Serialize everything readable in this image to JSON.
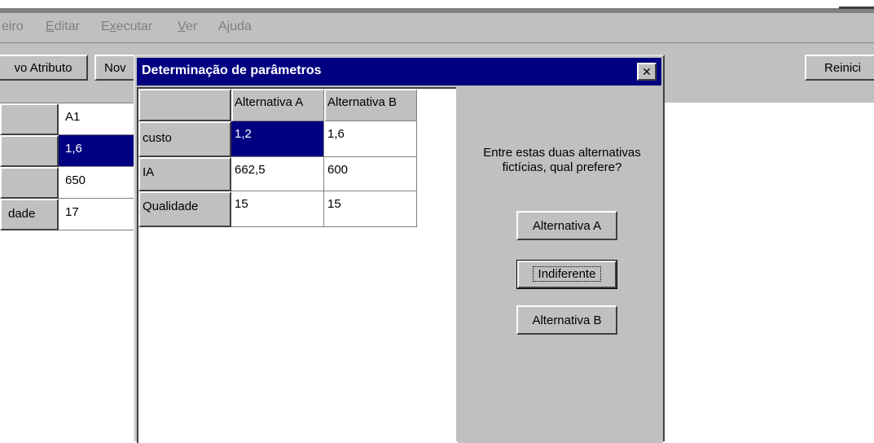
{
  "menu": {
    "items": [
      "eiro",
      "Editar",
      "Executar",
      "Ver",
      "Ajuda"
    ]
  },
  "toolbar": {
    "novo_atributo_label": "vo Atributo",
    "nov_label": "Nov",
    "reiniciar_label": "Reinici"
  },
  "background_grid": {
    "header": "A1",
    "rows": [
      {
        "label": "",
        "value": "1,6",
        "selected": true
      },
      {
        "label": "",
        "value": "650"
      },
      {
        "label": "dade",
        "value": "17"
      }
    ]
  },
  "dialog": {
    "title": "Determinação de parâmetros",
    "close_glyph": "✕",
    "columns": [
      "Alternativa A",
      "Alternativa B"
    ],
    "rows": [
      {
        "label": "custo",
        "a": "1,2",
        "b": "1,6"
      },
      {
        "label": "IA",
        "a": "662,5",
        "b": "600"
      },
      {
        "label": "Qualidade",
        "a": "15",
        "b": "15"
      }
    ],
    "prompt": "Entre estas duas alternativas fictícias, qual prefere?",
    "buttons": {
      "alt_a": "Alternativa A",
      "indiferente": "Indiferente",
      "alt_b": "Alternativa B"
    }
  },
  "colors": {
    "title_bar": "#000080",
    "face": "#c0c0c0",
    "selection": "#000080"
  }
}
